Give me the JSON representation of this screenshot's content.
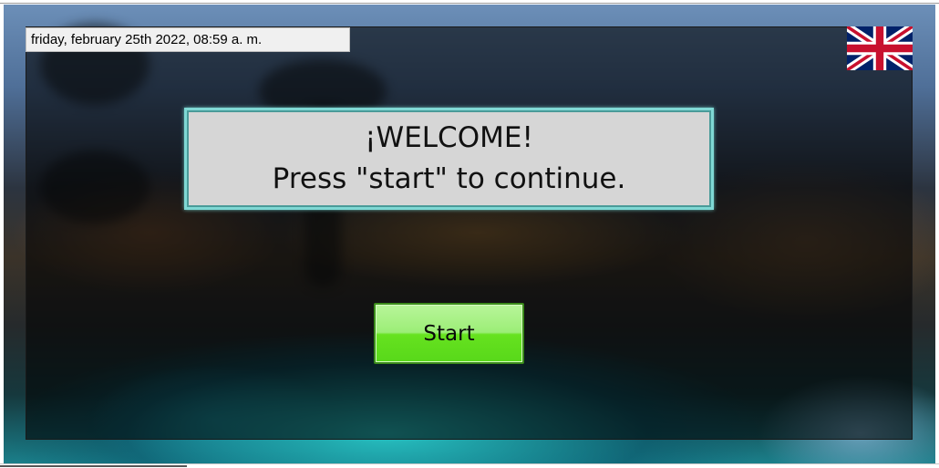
{
  "datetime": "friday, february 25th 2022, 08:59 a. m.",
  "welcome": {
    "line1": "¡WELCOME!",
    "line2": "Press \"start\" to continue."
  },
  "start_button": {
    "label": "Start"
  },
  "language_flag": {
    "icon": "uk-flag-icon"
  },
  "colors": {
    "start_button_top": "#b8f59a",
    "start_button_bottom": "#58d81a",
    "welcome_border": "#7fd8d4",
    "welcome_background": "#d6d6d6"
  }
}
